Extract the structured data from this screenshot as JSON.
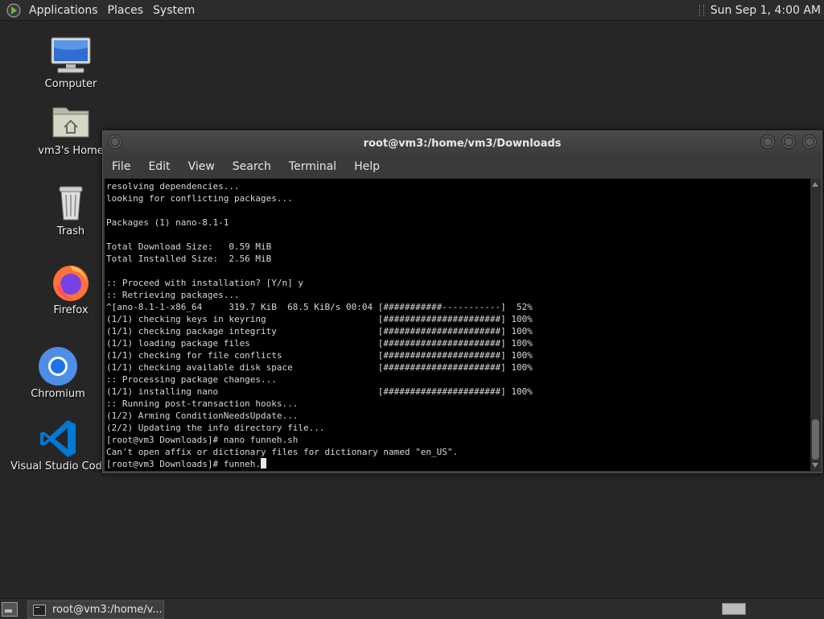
{
  "top_panel": {
    "menus": [
      "Applications",
      "Places",
      "System"
    ],
    "clock": "Sun Sep  1,  4:00 AM"
  },
  "desktop_icons": [
    {
      "label": "Computer",
      "icon": "computer-icon"
    },
    {
      "label": "vm3's Home",
      "icon": "home-folder-icon"
    },
    {
      "label": "Trash",
      "icon": "trash-icon"
    },
    {
      "label": "Firefox",
      "icon": "firefox-icon"
    },
    {
      "label": "Chromium",
      "icon": "chromium-icon"
    },
    {
      "label": "Visual Studio Code",
      "icon": "vscode-icon"
    }
  ],
  "terminal": {
    "title": "root@vm3:/home/vm3/Downloads",
    "menu": [
      "File",
      "Edit",
      "View",
      "Search",
      "Terminal",
      "Help"
    ],
    "lines": [
      "resolving dependencies...",
      "looking for conflicting packages...",
      "",
      "Packages (1) nano-8.1-1",
      "",
      "Total Download Size:   0.59 MiB",
      "Total Installed Size:  2.56 MiB",
      "",
      ":: Proceed with installation? [Y/n] y",
      ":: Retrieving packages...",
      "^[ano-8.1-1-x86_64     319.7 KiB  68.5 KiB/s 00:04 [###########-----------]  52%",
      "(1/1) checking keys in keyring                     [######################] 100%",
      "(1/1) checking package integrity                   [######################] 100%",
      "(1/1) loading package files                        [######################] 100%",
      "(1/1) checking for file conflicts                  [######################] 100%",
      "(1/1) checking available disk space                [######################] 100%",
      ":: Processing package changes...",
      "(1/1) installing nano                              [######################] 100%",
      ":: Running post-transaction hooks...",
      "(1/2) Arming ConditionNeedsUpdate...",
      "(2/2) Updating the info directory file...",
      "[root@vm3 Downloads]# nano funneh.sh",
      "Can't open affix or dictionary files for dictionary named \"en_US\"."
    ],
    "prompt": "[root@vm3 Downloads]# funneh."
  },
  "bottom_panel": {
    "task_label": "root@vm3:/home/v..."
  }
}
